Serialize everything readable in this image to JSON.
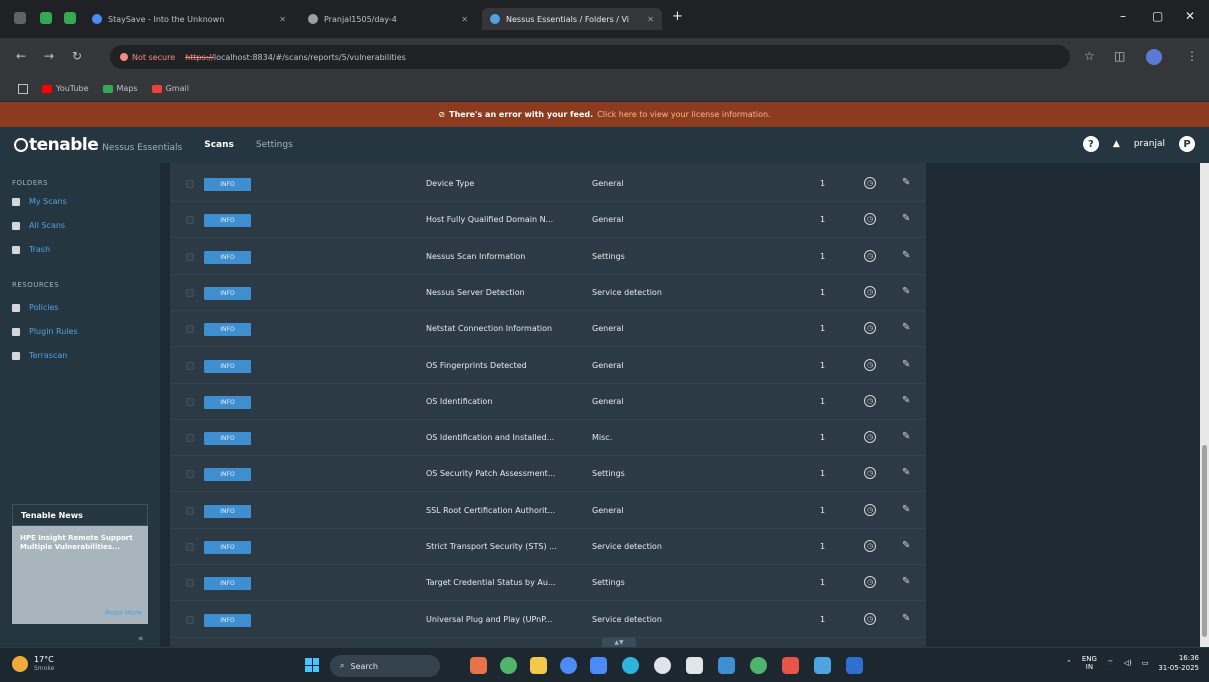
{
  "browser": {
    "tabs": [
      {
        "label": "StaySave - Into the Unknown",
        "active": false
      },
      {
        "label": "Pranjal1505/day-4",
        "active": false
      },
      {
        "label": "Nessus Essentials / Folders / Vi",
        "active": true
      }
    ],
    "new_tab": "+",
    "window_controls": {
      "minimize": "–",
      "maximize": "▢",
      "close": "✕"
    },
    "not_secure": "Not secure",
    "url_scheme": "https://",
    "url_rest": "localhost:8834/#/scans/reports/5/vulnerabilities",
    "bookmarks": [
      {
        "label": "YouTube",
        "color": "#ff0000"
      },
      {
        "label": "Maps",
        "color": "#34a853"
      },
      {
        "label": "Gmail",
        "color": "#ea4335"
      }
    ]
  },
  "banner": {
    "strong": "There's an error with your feed.",
    "link": "Click here to view your license information."
  },
  "header": {
    "logo": "tenable",
    "product": "Nessus Essentials",
    "nav": [
      {
        "label": "Scans",
        "active": true
      },
      {
        "label": "Settings",
        "active": false
      }
    ],
    "help": "?",
    "bell": "▲",
    "user": "pranjal",
    "avatar": "P"
  },
  "sidebar": {
    "folders_heading": "FOLDERS",
    "folders": [
      "My Scans",
      "All Scans",
      "Trash"
    ],
    "resources_heading": "RESOURCES",
    "resources": [
      "Policies",
      "Plugin Rules",
      "Terrascan"
    ],
    "news_title": "Tenable News",
    "news_body": "HPE Insight Remote Support Multiple Vulnerabilities...",
    "news_more": "Read More",
    "collapse": "«"
  },
  "vulns": {
    "severity_label": "INFO",
    "rows": [
      {
        "name": "Device Type",
        "family": "General",
        "count": "1"
      },
      {
        "name": "Host Fully Qualified Domain N...",
        "family": "General",
        "count": "1"
      },
      {
        "name": "Nessus Scan Information",
        "family": "Settings",
        "count": "1"
      },
      {
        "name": "Nessus Server Detection",
        "family": "Service detection",
        "count": "1"
      },
      {
        "name": "Netstat Connection Information",
        "family": "General",
        "count": "1"
      },
      {
        "name": "OS Fingerprints Detected",
        "family": "General",
        "count": "1"
      },
      {
        "name": "OS Identification",
        "family": "General",
        "count": "1"
      },
      {
        "name": "OS Identification and Installed...",
        "family": "Misc.",
        "count": "1"
      },
      {
        "name": "OS Security Patch Assessment...",
        "family": "Settings",
        "count": "1"
      },
      {
        "name": "SSL Root Certification Authorit...",
        "family": "General",
        "count": "1"
      },
      {
        "name": "Strict Transport Security (STS) ...",
        "family": "Service detection",
        "count": "1"
      },
      {
        "name": "Target Credential Status by Au...",
        "family": "Settings",
        "count": "1"
      },
      {
        "name": "Universal Plug and Play (UPnP...",
        "family": "Service detection",
        "count": "1"
      }
    ],
    "paging_toggle": "▲▼"
  },
  "taskbar": {
    "temp": "17°C",
    "weather": "Smoke",
    "search": "Search",
    "lang_top": "ENG",
    "lang_bottom": "IN",
    "time": "16:36",
    "date": "31-05-2025"
  }
}
